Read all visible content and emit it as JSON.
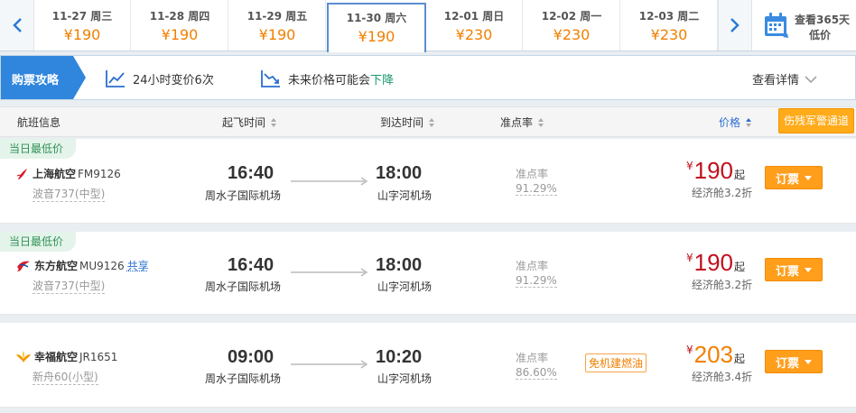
{
  "dates": [
    {
      "date": "11-27 周三",
      "price": "¥190"
    },
    {
      "date": "11-28 周四",
      "price": "¥190"
    },
    {
      "date": "11-29 周五",
      "price": "¥190"
    },
    {
      "date": "11-30 周六",
      "price": "¥190"
    },
    {
      "date": "12-01 周日",
      "price": "¥230"
    },
    {
      "date": "12-02 周一",
      "price": "¥230"
    },
    {
      "date": "12-03 周二",
      "price": "¥230"
    }
  ],
  "calendar": {
    "line1": "查看365天",
    "line2": "低价"
  },
  "tips": {
    "badge": "购票攻略",
    "change": "24小时变价6次",
    "forecast_prefix": "未来价格可能会",
    "forecast_trend": "下降",
    "detail": "查看详情"
  },
  "header": {
    "flight": "航班信息",
    "depart": "起飞时间",
    "arrive": "到达时间",
    "ontime": "准点率",
    "price": "价格",
    "military": "伤残军警通道"
  },
  "flights": [
    {
      "tag": "当日最低价",
      "airline": "上海航空",
      "flight_no": "FM9126",
      "share": "",
      "plane": "波音737(中型)",
      "dep_time": "16:40",
      "dep_airport": "周水子国际机场",
      "arr_time": "18:00",
      "arr_airport": "山字河机场",
      "ontime_label": "准点率",
      "ontime": "91.29%",
      "promo": "",
      "currency": "¥",
      "price": "190",
      "price_suffix": "起",
      "cabin": "经济舱3.2折",
      "book": "订票"
    },
    {
      "tag": "当日最低价",
      "airline": "东方航空",
      "flight_no": "MU9126",
      "share": "共享",
      "plane": "波音737(中型)",
      "dep_time": "16:40",
      "dep_airport": "周水子国际机场",
      "arr_time": "18:00",
      "arr_airport": "山字河机场",
      "ontime_label": "准点率",
      "ontime": "91.29%",
      "promo": "",
      "currency": "¥",
      "price": "190",
      "price_suffix": "起",
      "cabin": "经济舱3.2折",
      "book": "订票"
    },
    {
      "tag": "",
      "airline": "幸福航空",
      "flight_no": "JR1651",
      "share": "",
      "plane": "新舟60(小型)",
      "dep_time": "09:00",
      "dep_airport": "周水子国际机场",
      "arr_time": "10:20",
      "arr_airport": "山字河机场",
      "ontime_label": "准点率",
      "ontime": "86.60%",
      "promo": "免机建燃油",
      "currency": "¥",
      "price": "203",
      "price_suffix": "起",
      "cabin": "经济舱3.4折",
      "book": "订票"
    }
  ],
  "colors": {
    "accent_blue": "#2b6fd0",
    "price_orange": "#f27f00",
    "price_red": "#c0101e",
    "book_orange": "#ff9e1b",
    "tag_green": "#2f9257"
  },
  "icons": {
    "prev": "chevron-left-icon",
    "next": "chevron-right-icon",
    "calendar": "calendar-icon",
    "trend": "line-chart-icon",
    "down_trend": "down-trend-icon",
    "detail": "chevron-down-icon",
    "sort": "sort-icon",
    "book": "caret-down-icon"
  }
}
